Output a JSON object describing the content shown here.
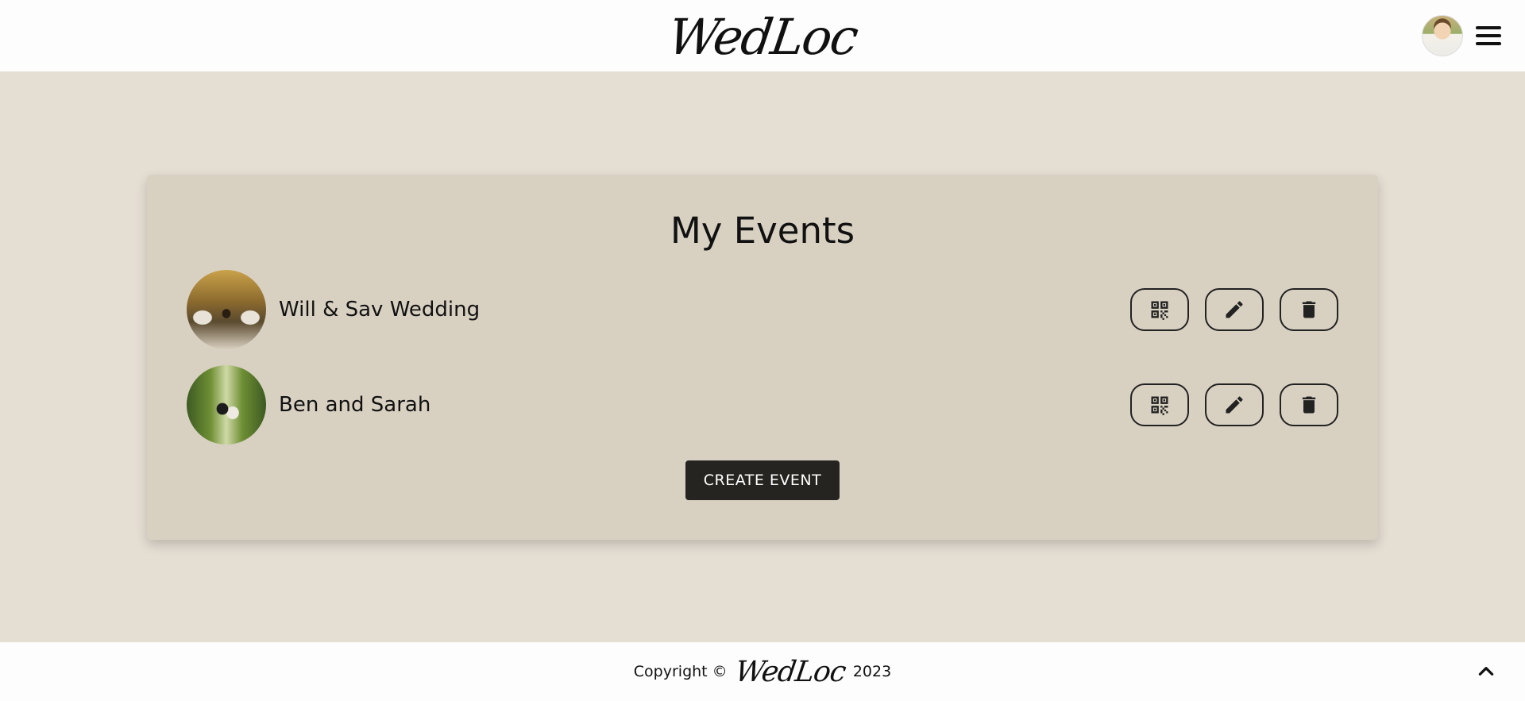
{
  "header": {
    "logo": "WedLoc",
    "avatar_icon": "user-avatar",
    "menu_icon": "hamburger-menu-icon"
  },
  "main": {
    "title": "My Events",
    "events": [
      {
        "name": "Will & Sav Wedding"
      },
      {
        "name": "Ben and Sarah"
      }
    ],
    "actions": {
      "qr_icon": "qr-code-icon",
      "edit_icon": "pencil-icon",
      "delete_icon": "trash-icon"
    },
    "create_button": "CREATE EVENT"
  },
  "footer": {
    "copyright_prefix": "Copyright ©",
    "logo": "WedLoc",
    "year": "2023",
    "scroll_top_icon": "chevron-up-icon"
  },
  "colors": {
    "page_bg": "#e5ded3",
    "card_bg": "#d8d1c2",
    "header_bg": "#fdfdfd",
    "button_dark": "#252420"
  }
}
